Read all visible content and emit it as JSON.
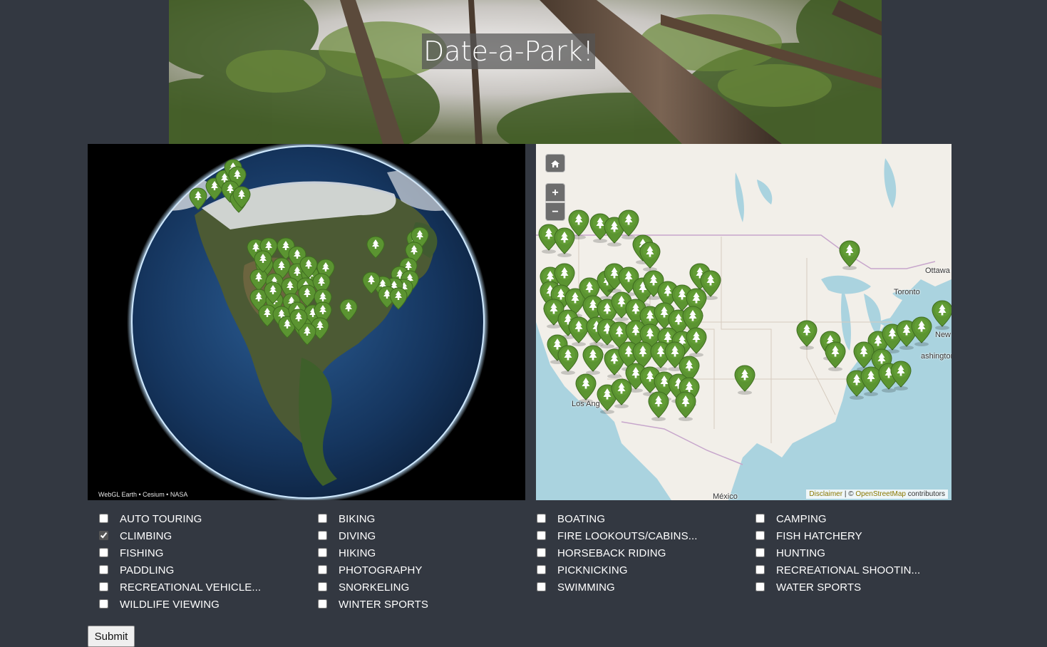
{
  "header": {
    "title": "Date-a-Park!"
  },
  "globe": {
    "credit": "WebGL Earth • Cesium • NASA",
    "marker_icon": "tree-icon"
  },
  "map": {
    "home_icon": "home-icon",
    "zoom_in": "+",
    "zoom_out": "−",
    "attribution": {
      "disclaimer": "Disclaimer",
      "separator": " | © ",
      "osm": "OpenStreetMap",
      "contributors": " contributors"
    },
    "places": [
      "Ottawa",
      "Toronto",
      "New",
      "ashington",
      "Los Ang",
      "México"
    ],
    "colors": {
      "water": "#aad3df",
      "land": "#f2efe9",
      "marker": "#5b9431",
      "border": "#c7a6cc"
    }
  },
  "activities": [
    {
      "label": "AUTO TOURING",
      "checked": false
    },
    {
      "label": "BIKING",
      "checked": false
    },
    {
      "label": "BOATING",
      "checked": false
    },
    {
      "label": "CAMPING",
      "checked": false
    },
    {
      "label": "CLIMBING",
      "checked": true
    },
    {
      "label": "DIVING",
      "checked": false
    },
    {
      "label": "FIRE LOOKOUTS/CABINS...",
      "checked": false
    },
    {
      "label": "FISH HATCHERY",
      "checked": false
    },
    {
      "label": "FISHING",
      "checked": false
    },
    {
      "label": "HIKING",
      "checked": false
    },
    {
      "label": "HORSEBACK RIDING",
      "checked": false
    },
    {
      "label": "HUNTING",
      "checked": false
    },
    {
      "label": "PADDLING",
      "checked": false
    },
    {
      "label": "PHOTOGRAPHY",
      "checked": false
    },
    {
      "label": "PICKNICKING",
      "checked": false
    },
    {
      "label": "RECREATIONAL SHOOTIN...",
      "checked": false
    },
    {
      "label": "RECREATIONAL VEHICLE...",
      "checked": false
    },
    {
      "label": "SNORKELING",
      "checked": false
    },
    {
      "label": "SWIMMING",
      "checked": false
    },
    {
      "label": "WATER SPORTS",
      "checked": false
    },
    {
      "label": "WILDLIFE VIEWING",
      "checked": false
    },
    {
      "label": "WINTER SPORTS",
      "checked": false
    }
  ],
  "submit_label": "Submit"
}
